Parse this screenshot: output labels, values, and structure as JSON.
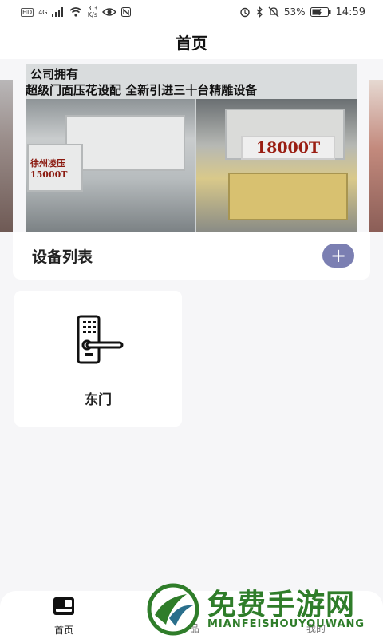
{
  "status_bar": {
    "hd": "HD",
    "network": "4G",
    "speed_value": "3.3",
    "speed_unit": "K/s",
    "battery": "53%",
    "time": "14:59"
  },
  "header": {
    "title": "首页"
  },
  "banner": {
    "caption_line1": "公司拥有",
    "caption_line2": "超级门面压花设配  全新引进三十台精雕设备",
    "label_right": "18000T",
    "label_left": "徐州凌压 15000T"
  },
  "device_list": {
    "title": "设备列表",
    "add_symbol": "+",
    "items": [
      {
        "name": "东门",
        "icon": "door-lock-icon"
      }
    ]
  },
  "bottom_nav": {
    "items": [
      {
        "label": "首页",
        "icon": "home-card-icon",
        "active": true
      },
      {
        "label": "品",
        "icon": ""
      },
      {
        "label": "我的",
        "icon": ""
      }
    ]
  },
  "watermark": {
    "title": "免费手游网",
    "subtitle": "MIANFEISHOUYOUWANG"
  },
  "colors": {
    "accent": "#7b7fb2",
    "watermark": "#2f7d2a",
    "background": "#f6f6f8"
  }
}
